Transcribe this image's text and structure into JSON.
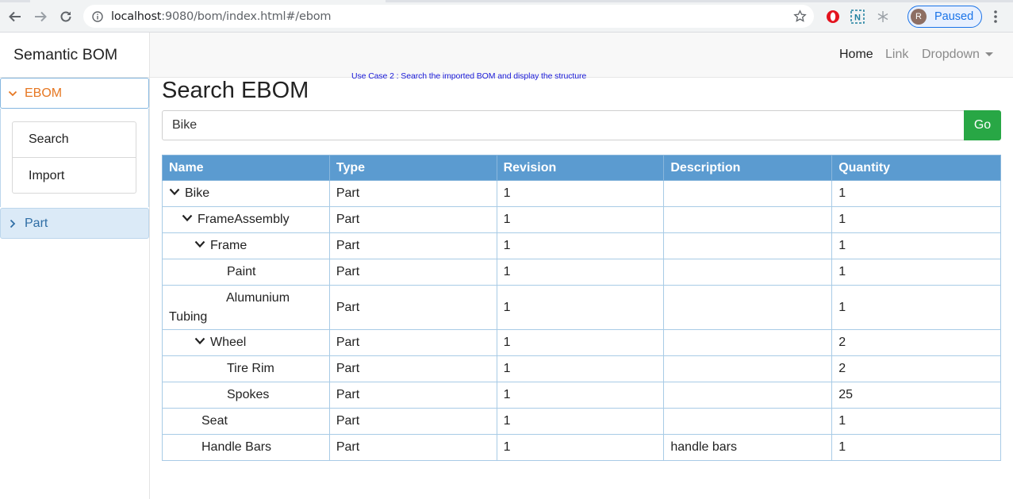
{
  "browser": {
    "url_host": "localhost",
    "url_rest": ":9080/bom/index.html#/ebom",
    "profile_initial": "R",
    "profile_status": "Paused"
  },
  "app": {
    "brand": "Semantic BOM",
    "sidebar": {
      "ebom_label": "EBOM",
      "menu": [
        "Search",
        "Import"
      ],
      "part_label": "Part"
    },
    "nav": {
      "home": "Home",
      "link": "Link",
      "dropdown": "Dropdown"
    },
    "usecase_note": "Use Case 2 : Search the imported BOM and display the structure",
    "page_title": "Search EBOM",
    "search": {
      "value": "Bike",
      "go_label": "Go"
    },
    "table": {
      "columns": [
        "Name",
        "Type",
        "Revision",
        "Description",
        "Quantity"
      ],
      "rows": [
        {
          "name": "Bike",
          "type": "Part",
          "revision": "1",
          "description": "",
          "quantity": "1"
        },
        {
          "name": "FrameAssembly",
          "type": "Part",
          "revision": "1",
          "description": "",
          "quantity": "1"
        },
        {
          "name": "Frame",
          "type": "Part",
          "revision": "1",
          "description": "",
          "quantity": "1"
        },
        {
          "name": "Paint",
          "type": "Part",
          "revision": "1",
          "description": "",
          "quantity": "1"
        },
        {
          "name": "Alumunium Tubing",
          "type": "Part",
          "revision": "1",
          "description": "",
          "quantity": "1"
        },
        {
          "name": "Wheel",
          "type": "Part",
          "revision": "1",
          "description": "",
          "quantity": "2"
        },
        {
          "name": "Tire Rim",
          "type": "Part",
          "revision": "1",
          "description": "",
          "quantity": "2"
        },
        {
          "name": "Spokes",
          "type": "Part",
          "revision": "1",
          "description": "",
          "quantity": "25"
        },
        {
          "name": "Seat",
          "type": "Part",
          "revision": "1",
          "description": "",
          "quantity": "1"
        },
        {
          "name": "Handle Bars",
          "type": "Part",
          "revision": "1",
          "description": "handle bars",
          "quantity": "1"
        }
      ]
    }
  },
  "colors": {
    "accent_orange": "#e67722",
    "header_blue": "#5b9bd0",
    "go_green": "#28a745",
    "note_blue": "#1a1ad8"
  }
}
